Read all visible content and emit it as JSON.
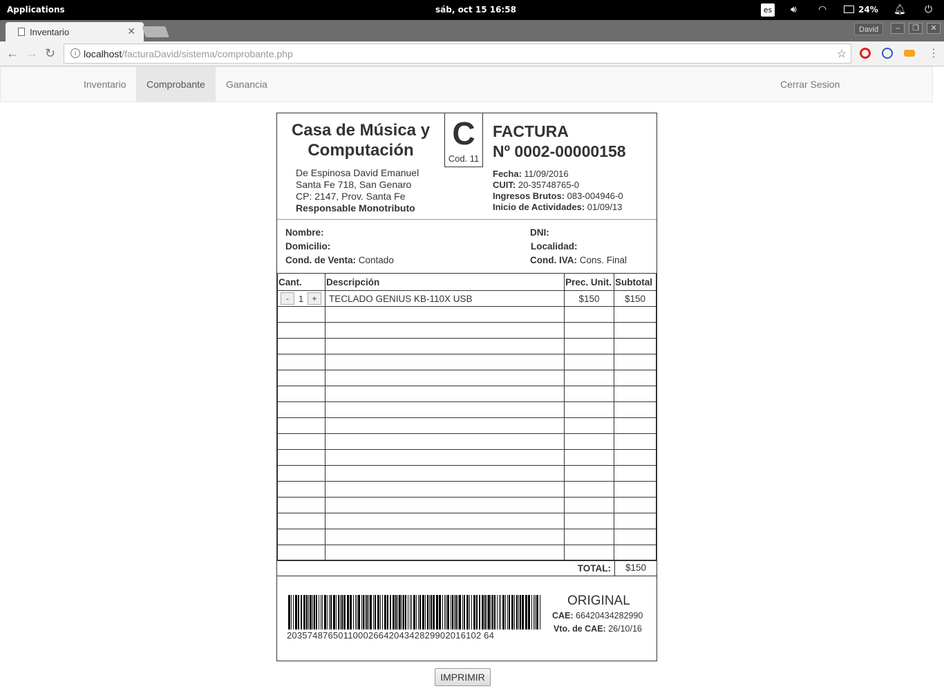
{
  "system_bar": {
    "applications": "Applications",
    "datetime": "sáb, oct 15   16:58",
    "lang": "es",
    "battery": "24%"
  },
  "browser": {
    "tab_title": "Inventario",
    "profile": "David",
    "url_host": "localhost",
    "url_path": "/facturaDavid/sistema/comprobante.php"
  },
  "nav": {
    "inventario": "Inventario",
    "comprobante": "Comprobante",
    "ganancia": "Ganancia",
    "logout": "Cerrar Sesion"
  },
  "invoice": {
    "business_name_1": "Casa de Música y",
    "business_name_2": "Computación",
    "letter": "C",
    "code": "Cod. 11",
    "owner": "De Espinosa David Emanuel",
    "address": "Santa Fe 718, San Genaro",
    "cp": "CP: 2147, Prov. Santa Fe",
    "tax_status": "Responsable Monotributo",
    "doc_type": "FACTURA",
    "number": "Nº 0002-00000158",
    "fecha_label": "Fecha:",
    "fecha": "11/09/2016",
    "cuit_label": "CUIT:",
    "cuit": "20-35748765-0",
    "iibb_label": "Ingresos Brutos:",
    "iibb": "083-004946-0",
    "inicio_label": "Inicio de Actividades:",
    "inicio": "01/09/13",
    "client": {
      "nombre_label": "Nombre:",
      "dni_label": "DNI:",
      "domicilio_label": "Domicilio:",
      "localidad_label": "Localidad:",
      "cond_venta_label": "Cond. de Venta:",
      "cond_venta": "Contado",
      "cond_iva_label": "Cond. IVA:",
      "cond_iva": "Cons. Final"
    },
    "columns": {
      "cant": "Cant.",
      "desc": "Descripción",
      "prec": "Prec. Unit.",
      "subtotal": "Subtotal"
    },
    "items": [
      {
        "minus": "-",
        "qty": "1",
        "plus": "+",
        "desc": "TECLADO GENIUS KB-110X USB",
        "price": "$150",
        "subtotal": "$150"
      }
    ],
    "total_label": "TOTAL:",
    "total": "$150",
    "barcode_number": "20357487650110002664204342829902016102 64",
    "copy": "ORIGINAL",
    "cae_label": "CAE:",
    "cae": "66420434282990",
    "vto_label": "Vto. de CAE:",
    "vto": "26/10/16"
  },
  "print_button": "IMPRIMIR"
}
